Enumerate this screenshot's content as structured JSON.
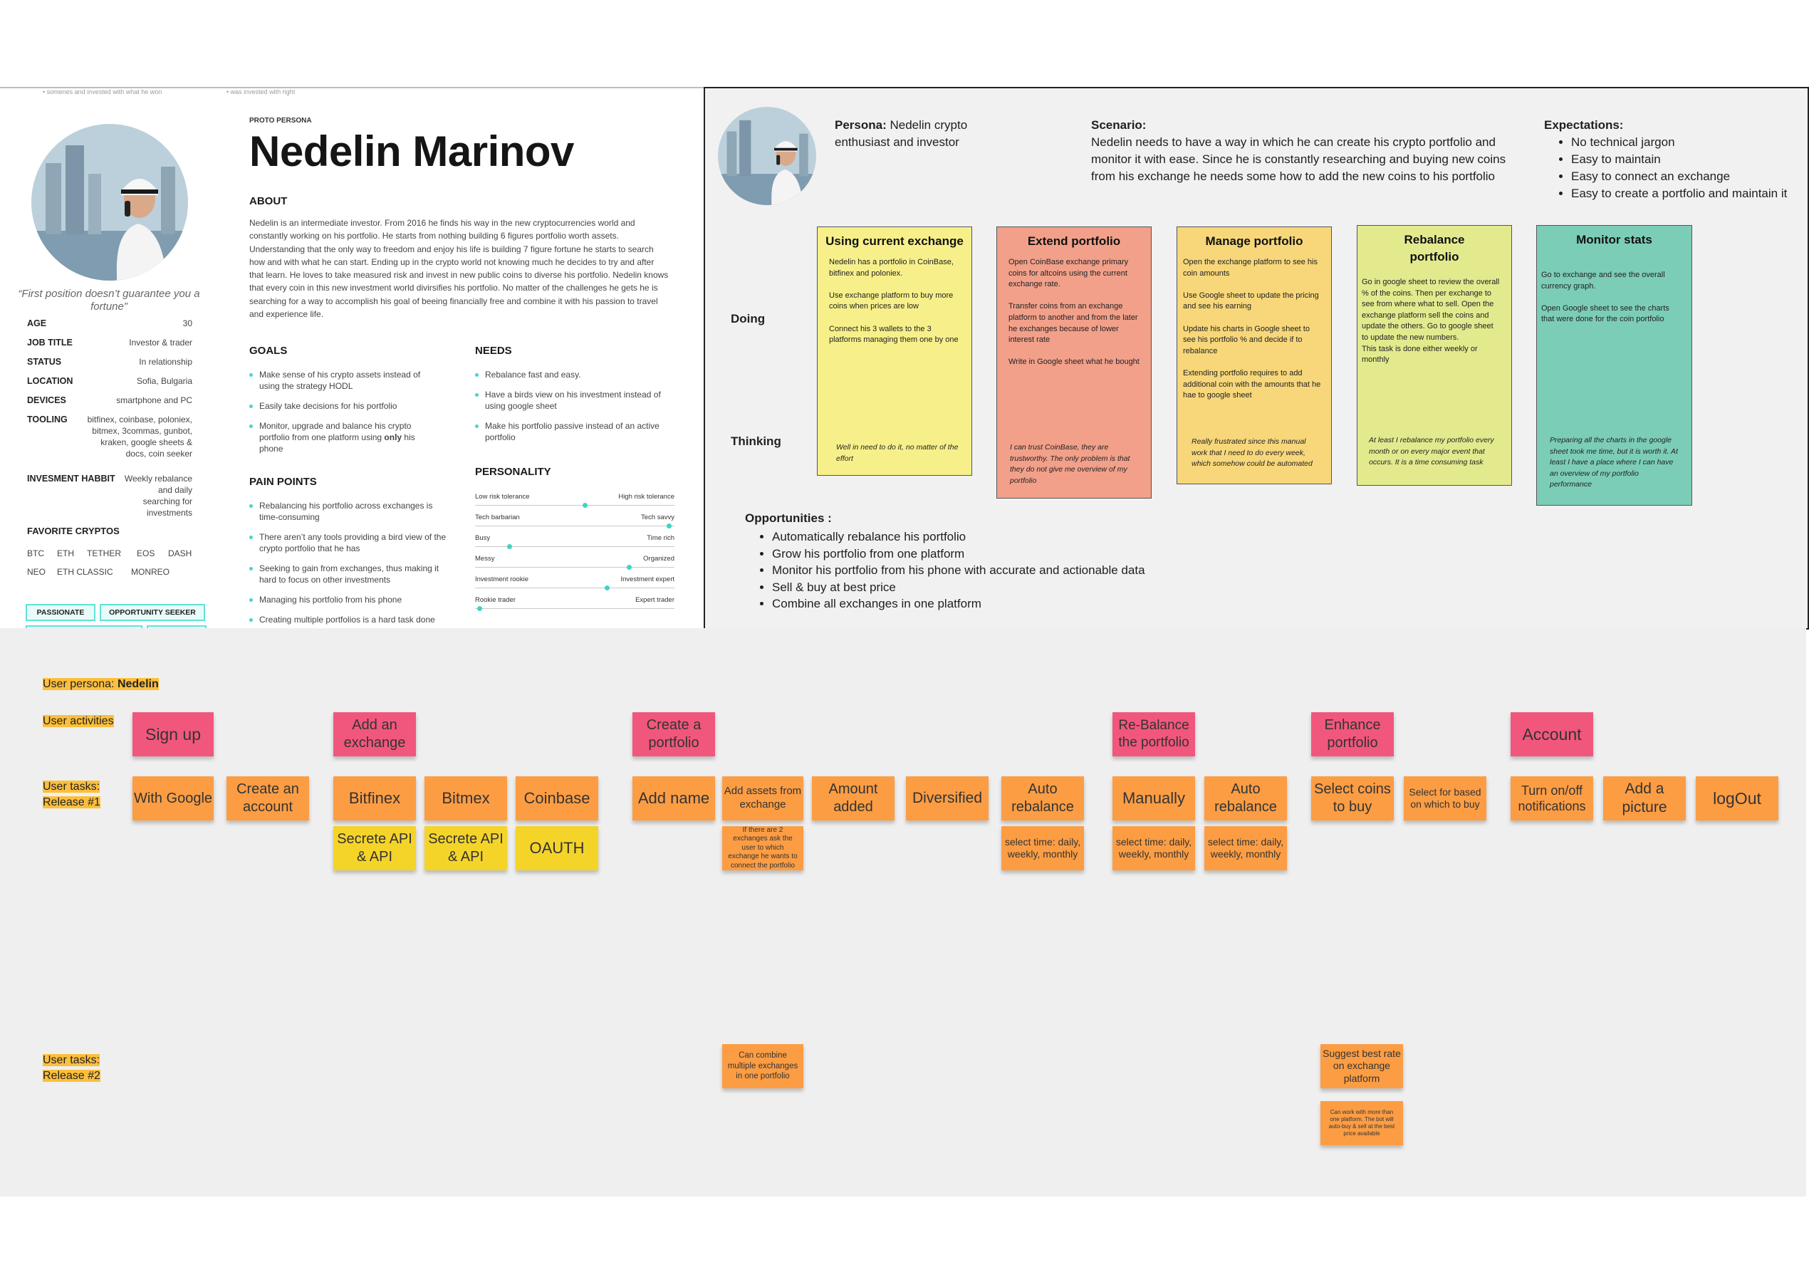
{
  "persona": {
    "cut_text_left": "• somenes and invested with what he won",
    "cut_text_right": "• was invested with right",
    "quote": "“First position doesn’t guarantee you a fortune”",
    "attributes": [
      {
        "key": "AGE",
        "value": "30"
      },
      {
        "key": "JOB TITLE",
        "value": "Investor & trader"
      },
      {
        "key": "STATUS",
        "value": "In relationship"
      },
      {
        "key": "LOCATION",
        "value": "Sofia, Bulgaria"
      },
      {
        "key": "DEVICES",
        "value": "smartphone and PC"
      },
      {
        "key": "TOOLING",
        "value": "bitfinex, coinbase, poloniex, bitmex, 3commas, gunbot, kraken, google sheets & docs, coin seeker"
      },
      {
        "key": "INVESMENT HABBIT",
        "value": "Weekly rebalance and daily searching for investments"
      }
    ],
    "favorite_cryptos_label": "FAVORITE CRYPTOS",
    "cryptos": [
      "BTC",
      "ETH",
      "TETHER",
      "EOS",
      "DASH",
      "NEO",
      "ETH CLASSIC",
      "MONREO"
    ],
    "tags": [
      "PASSIONATE",
      "OPPORTUNITY SEEKER"
    ],
    "proto_label": "PROTO PERSONA",
    "name": "Nedelin Marinov",
    "about_label": "ABOUT",
    "about_text": "Nedelin is an intermediate investor. From 2016 he finds his way in the new cryptocurrencies world and constantly working on his portfolio. He starts from nothing building 6 figures portfolio worth assets. Understanding that the only way to freedom and enjoy his life is building 7 figure fortune he starts to search how and with what he can start. Ending up in the crypto world not knowing much he decides to try and after that learn. He loves to take measured risk and invest in new public coins to diverse his portfolio. Nedelin knows that every coin in this new investment world divirsifies his portfolio. No matter of the challenges he gets he is searching for a way to accomplish his goal of beeing financially free and combine it with his passion to travel and experience life.",
    "goals_label": "GOALS",
    "goals": [
      "Make sense of his crypto assets instead of using the strategy HODL",
      "Easily take decisions for his portfolio",
      "Monitor, upgrade and balance his crypto portfolio from one platform using only his phone"
    ],
    "needs_label": "NEEDS",
    "needs": [
      "Rebalance fast and easy.",
      "Have a birds view on his investment instead of using google sheet",
      "Make his portfolio passive instead of an active portfolio"
    ],
    "pain_label": "PAIN POINTS",
    "pain_points": [
      "Rebalancing his portfolio across exchanges is time-consuming",
      "There aren’t any tools providing a bird view of the crypto portfolio that he has",
      "Seeking to gain from exchanges, thus making it hard to focus on other investments",
      "Managing his portfolio from his phone",
      "Creating multiple portfolios is a hard task done"
    ],
    "personality_label": "PERSONALITY",
    "personality": [
      {
        "left": "Low risk tolerance",
        "right": "High risk tolerance",
        "value": 0.55
      },
      {
        "left": "Tech barbarian",
        "right": "Tech savvy",
        "value": 0.97
      },
      {
        "left": "Busy",
        "right": "Time rich",
        "value": 0.17
      },
      {
        "left": "Messy",
        "right": "Organized",
        "value": 0.77
      },
      {
        "left": "Investment rookie",
        "right": "Investment expert",
        "value": 0.66
      },
      {
        "left": "Rookie trader",
        "right": "Expert trader",
        "value": 0.02
      }
    ]
  },
  "scenario": {
    "persona_label": "Persona:",
    "persona_text": "Nedelin crypto enthusiast and investor",
    "scenario_label": "Scenario:",
    "scenario_text": "Nedelin needs to have a way in which he can create his crypto portfolio and monitor it with ease. Since he is constantly researching and buying new coins from his exchange he needs some how to add the new coins to his portfolio",
    "expectations_label": "Expectations:",
    "expectations": [
      "No technical jargon",
      "Easy to maintain",
      "Easy to connect an exchange",
      "Easy to create a portfolio and maintain it"
    ],
    "doing_label": "Doing",
    "thinking_label": "Thinking",
    "stages": [
      {
        "title": "Using current exchange",
        "color": "#f7f08a",
        "doing": "Nedelin has a portfolio in CoinBase, bitfinex and poloniex.\n\nUse exchange platform to buy more coins when prices are low\n\nConnect his 3 wallets to the 3 platforms managing them one by one",
        "thinking": "Well in need to do it, no matter of the effort"
      },
      {
        "title": "Extend portfolio",
        "color": "#f2a08a",
        "doing": "Open CoinBase exchange primary coins for altcoins using the current exchange rate.\n\nTransfer coins from an exchange platform to another and from the later he exchanges because of lower interest rate\n\nWrite in Google sheet what he bought",
        "thinking": "I can trust CoinBase, they are trustworthy. The only problem is that they do not give me overview of my portfolio"
      },
      {
        "title": "Manage portfolio",
        "color": "#f7d77a",
        "doing": "Open the exchange platform to see his coin amounts\n\nUse Google sheet to update the pricing and see his earning\n\nUpdate his charts in Google sheet to see his portfolio % and decide if to rebalance\n\nExtending portfolio requires to add additional coin with the amounts that he hae to google sheet",
        "thinking": "Really frustrated since this manual work that I need to do every week, which somehow could be automated"
      },
      {
        "title": "Rebalance portfolio",
        "color": "#e3ea8e",
        "doing": "Go in google sheet to review the overall % of the coins. Then per exchange to see from where what to sell. Open the exchange platform sell the coins and update the others. Go to google sheet to update the new numbers.\nThis task is done either weekly or monthly",
        "thinking": "At least I rebalance my portfolio every month or on every major event that occurs. It is a time consuming task"
      },
      {
        "title": "Monitor stats",
        "color": "#7ccdb8",
        "doing": "Go to exchange and see the overall currency graph.\n\nOpen Google sheet to see the charts that were done for the coin portfolio",
        "thinking": "Preparing all the charts in the google sheet took me time, but it is worth it. At least I have a place where I can have an overview of my portfolio performance"
      }
    ],
    "opportunities_label": "Opportunities :",
    "opportunities": [
      "Automatically rebalance his portfolio",
      "Grow his portfolio from one platform",
      "Monitor his portfolio from his phone with accurate and actionable data",
      "Sell & buy at best price",
      "Combine all exchanges in one platform"
    ]
  },
  "storymap": {
    "persona_prefix": "User persona: ",
    "persona_name": "Nedelin",
    "activities_label": "User activities",
    "release1_label": [
      "User tasks:",
      "Release #1"
    ],
    "release2_label": [
      "User tasks:",
      "Release #2"
    ],
    "activities": [
      "Sign up",
      "Add an exchange",
      "Create a portfolio",
      "Re-Balance the portfolio",
      "Enhance portfolio",
      "Account"
    ],
    "tasks": [
      "With Google",
      "Create an account",
      "Bitfinex",
      "Bitmex",
      "Coinbase",
      "Add name",
      "Add assets from exchange",
      "Amount added",
      "Diversified",
      "Auto rebalance",
      "Manually",
      "Auto rebalance",
      "Select coins to buy",
      "Select for based on which to buy",
      "Turn on/off notifications",
      "Add a picture",
      "logOut"
    ],
    "subtasks": [
      "Secrete API & API",
      "Secrete API & API",
      "OAUTH",
      "If there are 2 exchanges ask the user to which exchange he wants to connect the portfolio",
      "select time: daily, weekly, monthly",
      "select time: daily, weekly, monthly",
      "select time: daily, weekly, monthly"
    ],
    "release2": [
      "Can combine multiple exchanges in one portfolio",
      "Suggest best rate on exchange platform",
      "Can work with more than one platform. The bot will auto-buy & sell at the best price available"
    ]
  },
  "colors": {
    "sticky_pink": "#f1577c",
    "sticky_orange": "#fc9d44",
    "sticky_yellow": "#f5d42a",
    "accent_teal": "#45d6c8",
    "label_highlight": "#fcbf3b"
  }
}
